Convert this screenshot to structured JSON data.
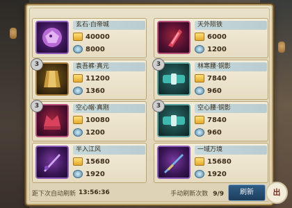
{
  "items": [
    {
      "name": "玄石·白帝城",
      "gold": "40000",
      "coin": "8000",
      "thumb": "purple",
      "badge": "",
      "icon": "dragon-gem-icon"
    },
    {
      "name": "天外陨铁",
      "gold": "6000",
      "coin": "1200",
      "thumb": "red",
      "badge": "",
      "icon": "red-crystal-icon"
    },
    {
      "name": "袁吾裤·真元",
      "gold": "11200",
      "coin": "1360",
      "thumb": "gold",
      "badge": "3",
      "icon": "gold-skirt-icon"
    },
    {
      "name": "林寒腰·铜影",
      "gold": "7840",
      "coin": "960",
      "thumb": "teal",
      "badge": "3",
      "icon": "teal-belt-icon"
    },
    {
      "name": "空心帽·真刚",
      "gold": "10080",
      "coin": "1200",
      "thumb": "red",
      "badge": "3",
      "icon": "red-crown-icon"
    },
    {
      "name": "空心腰·铜影",
      "gold": "7840",
      "coin": "960",
      "thumb": "teal",
      "badge": "3",
      "icon": "teal-belt-icon"
    },
    {
      "name": "半入江风",
      "gold": "15680",
      "coin": "1920",
      "thumb": "purple",
      "badge": "",
      "icon": "purple-dagger-icon"
    },
    {
      "name": "一域万境",
      "gold": "15680",
      "coin": "1920",
      "thumb": "purple",
      "badge": "",
      "icon": "blue-sword-icon"
    }
  ],
  "footer": {
    "auto_refresh_label": "距下次自动刷新",
    "auto_refresh_time": "13:56:36",
    "manual_refresh_label": "手动刷新次数",
    "manual_refresh_count": "9/9",
    "refresh_button": "刷新"
  },
  "corner_logo_text": "出"
}
